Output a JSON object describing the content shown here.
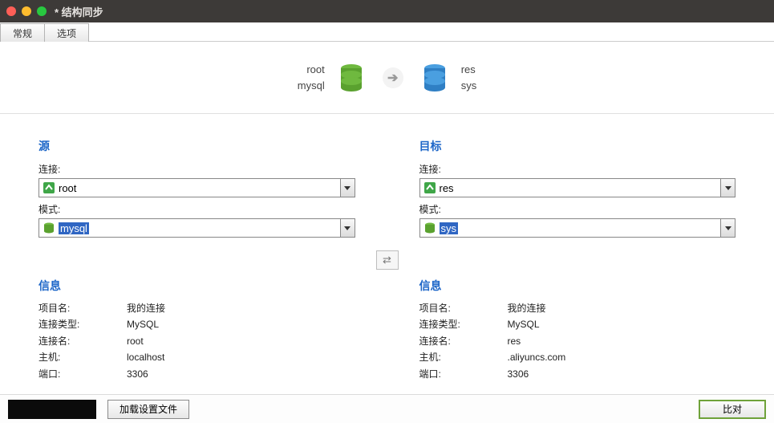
{
  "window": {
    "title": "* 结构同步"
  },
  "tabs": {
    "general": "常规",
    "options": "选项"
  },
  "diagram": {
    "src_conn": "root",
    "src_schema": "mysql",
    "dst_conn": "res",
    "dst_schema": "sys"
  },
  "source": {
    "title": "源",
    "conn_label": "连接:",
    "conn_value": "root",
    "schema_label": "模式:",
    "schema_value": "mysql"
  },
  "target": {
    "title": "目标",
    "conn_label": "连接:",
    "conn_value": "res",
    "schema_label": "模式:",
    "schema_value": "sys"
  },
  "info_title": "信息",
  "info_labels": {
    "project": "项目名:",
    "type": "连接类型:",
    "conn": "连接名:",
    "host": "主机:",
    "port": "端口:"
  },
  "source_info": {
    "project": "我的连接",
    "type": "MySQL",
    "conn": "root",
    "host": "localhost",
    "port": "3306"
  },
  "target_info": {
    "project": "我的连接",
    "type": "MySQL",
    "conn": "res",
    "host": ".aliyuncs.com",
    "port": "3306"
  },
  "footer": {
    "load_settings": "加载设置文件",
    "compare": "比对"
  }
}
